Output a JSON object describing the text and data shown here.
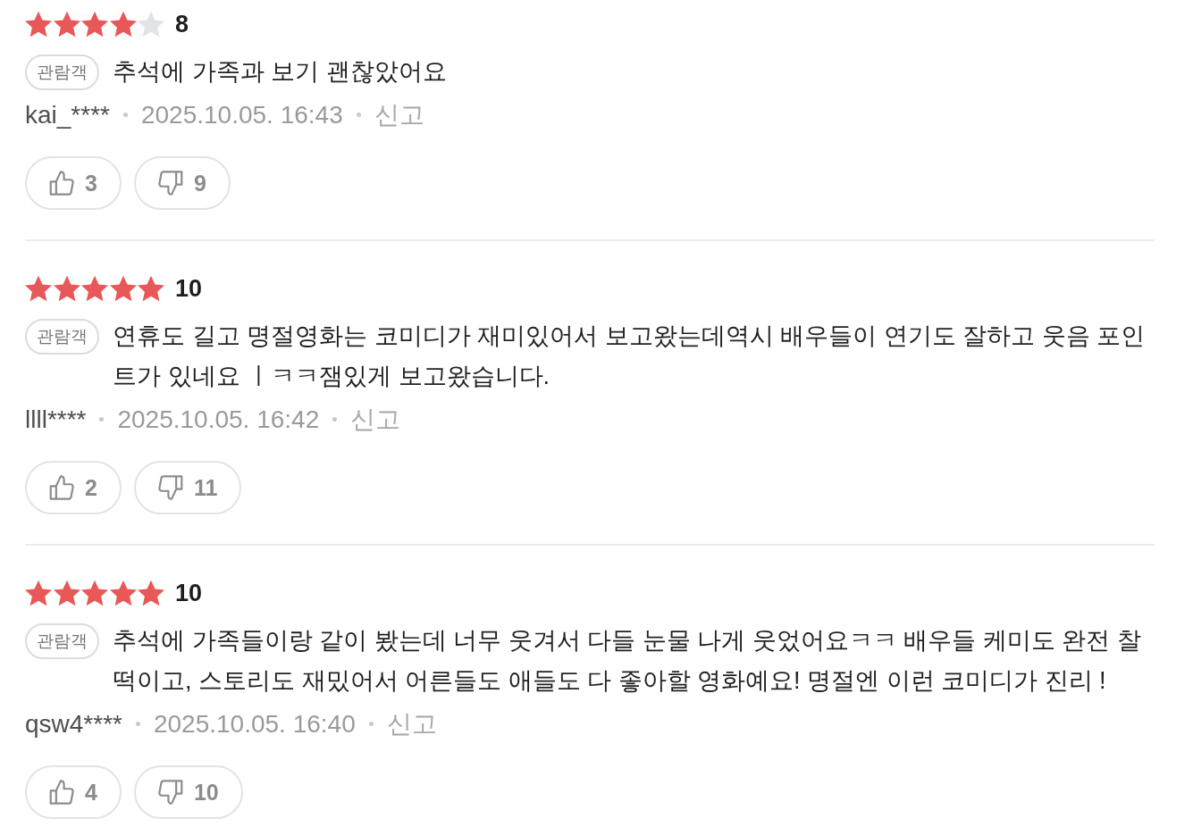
{
  "reviews": [
    {
      "stars": 4,
      "score": "8",
      "badge": "관람객",
      "comment": "추석에 가족과 보기 괜찮았어요",
      "author": "kai_****",
      "date": "2025.10.05. 16:43",
      "report": "신고",
      "likes": "3",
      "dislikes": "9"
    },
    {
      "stars": 5,
      "score": "10",
      "badge": "관람객",
      "comment": "연휴도 길고 명절영화는 코미디가 재미있어서 보고왔는데역시 배우들이 연기도 잘하고 웃음 포인트가 있네요 ㅣㅋㅋ잼있게 보고왔습니다.",
      "author": "llll****",
      "date": "2025.10.05. 16:42",
      "report": "신고",
      "likes": "2",
      "dislikes": "11"
    },
    {
      "stars": 5,
      "score": "10",
      "badge": "관람객",
      "comment": "추석에 가족들이랑 같이 봤는데 너무 웃겨서 다들 눈물 나게 웃었어요ㅋㅋ 배우들 케미도 완전 찰떡이고, 스토리도 재밌어서 어른들도 애들도 다 좋아할 영화예요! 명절엔 이런 코미디가 진리 !",
      "author": "qsw4****",
      "date": "2025.10.05. 16:40",
      "report": "신고",
      "likes": "4",
      "dislikes": "10"
    }
  ]
}
